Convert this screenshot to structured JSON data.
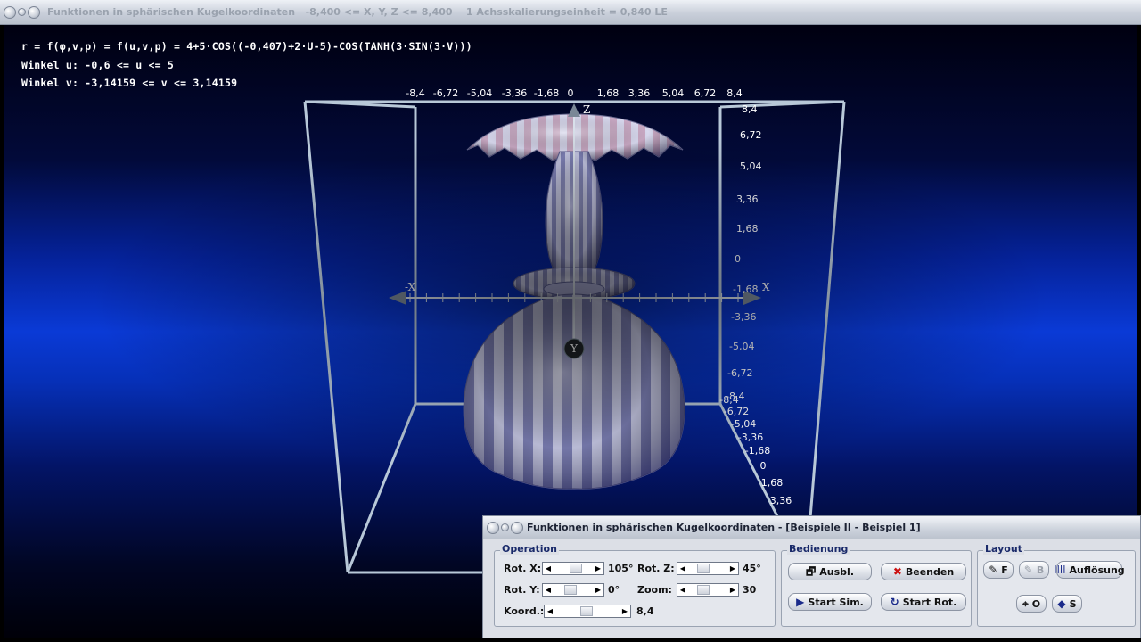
{
  "window": {
    "title": "Funktionen in sphärischen Kugelkoordinaten   -8,400 <= X, Y, Z <= 8,400    1 Achsskalierungseinheit = 0,840 LE"
  },
  "info": {
    "formula": "r = f(φ,v,p) = f(u,v,p) = 4+5·COS((-0,407)+2·U-5)-COS(TANH(3·SIN(3·V)))",
    "angle_u": "Winkel u: -0,6 <= u <= 5",
    "angle_v": "Winkel v: -3,14159 <= v <= 3,14159"
  },
  "axes": {
    "x_ticks": [
      "-8,4",
      "-6,72",
      "-5,04",
      "-3,36",
      "-1,68",
      "0",
      "1,68",
      "3,36",
      "5,04",
      "6,72",
      "8,4"
    ],
    "z_ticks": [
      "8,4",
      "6,72",
      "5,04",
      "3,36",
      "1,68",
      "0",
      "-1,68",
      "-3,36",
      "-5,04",
      "-6,72",
      "-8,4"
    ],
    "y_ticks": [
      "-8,4",
      "-6,72",
      "-5,04",
      "-3,36",
      "-1,68",
      "0",
      "1,68",
      "3,36"
    ],
    "label_x": "X",
    "label_neg_x": "-X",
    "label_z": "Z",
    "label_y": "Y"
  },
  "panel": {
    "title": "Funktionen in sphärischen Kugelkoordinaten - [Beispiele II - Beispiel 1]",
    "operation": {
      "label": "Operation",
      "rot_x_label": "Rot. X:",
      "rot_x_value": "105°",
      "rot_y_label": "Rot. Y:",
      "rot_y_value": "0°",
      "rot_z_label": "Rot. Z:",
      "rot_z_value": "45°",
      "zoom_label": "Zoom:",
      "zoom_value": "30",
      "koord_label": "Koord.:",
      "koord_value": "8,4"
    },
    "bedienung": {
      "label": "Bedienung",
      "ausbl": "Ausbl.",
      "beenden": "Beenden",
      "start_sim": "Start Sim.",
      "start_rot": "Start Rot."
    },
    "layout": {
      "label": "Layout",
      "f": "F",
      "b": "B",
      "aufloesung": "Auflösung",
      "o": "O",
      "s": "S"
    }
  },
  "colors": {
    "surface_light": "#c9cbe8",
    "surface_dark": "#7d80b6",
    "frame": "#b8c8d8",
    "accent_red": "#cc1111",
    "label_blue": "#1a2a6a"
  }
}
